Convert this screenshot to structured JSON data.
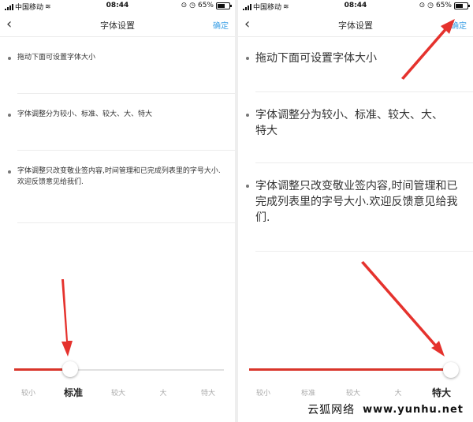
{
  "status_bar": {
    "carrier": "中国移动",
    "time": "08:44",
    "battery": "65%"
  },
  "nav": {
    "back_icon": "chevron-left-icon",
    "title": "字体设置",
    "confirm_label": "确定"
  },
  "content": {
    "items": [
      "拖动下面可设置字体大小",
      "字体调整分为较小、标准、较大、大、特大",
      "字体调整只改变敬业签内容,时间管理和已完成列表里的字号大小.欢迎反馈意见给我们."
    ]
  },
  "slider": {
    "options": [
      "较小",
      "标准",
      "较大",
      "大",
      "特大"
    ],
    "left_selected": "标准",
    "right_selected": "特大"
  },
  "watermark": {
    "text": "云狐网络",
    "url": "www.yunhu.net"
  },
  "colors": {
    "accent": "#3ca0e6",
    "slider_fill": "#d9352a",
    "arrow": "#e5322d"
  }
}
